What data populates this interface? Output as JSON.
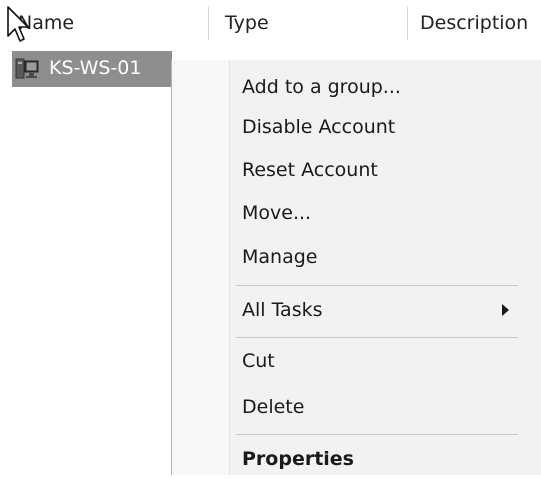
{
  "list_view": {
    "columns": [
      "Name",
      "Type",
      "Description"
    ],
    "selected_row": {
      "name": "KS-WS-01",
      "icon": "computer-icon"
    }
  },
  "context_menu": {
    "items": [
      {
        "label": "Add to a group..."
      },
      {
        "label": "Disable Account"
      },
      {
        "label": "Reset Account"
      },
      {
        "label": "Move..."
      },
      {
        "label": "Manage"
      },
      {
        "label": "All Tasks",
        "has_submenu": true
      },
      {
        "label": "Cut"
      },
      {
        "label": "Delete"
      },
      {
        "label": "Properties",
        "bold": true
      }
    ]
  },
  "cursor": "mouse-pointer-icon"
}
